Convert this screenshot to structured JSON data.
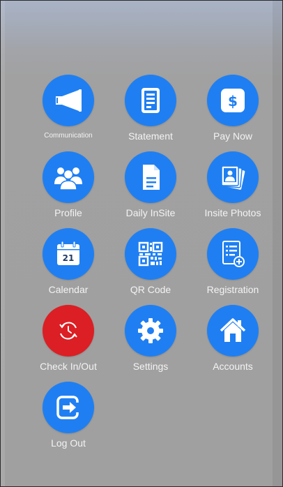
{
  "menu": {
    "communication": "Communication",
    "statement": "Statement",
    "pay_now": "Pay Now",
    "profile": "Profile",
    "daily_insite": "Daily InSite",
    "insite_photos": "Insite Photos",
    "calendar": "Calendar",
    "calendar_day": "21",
    "qr_code": "QR Code",
    "registration": "Registration",
    "check_in_out": "Check In/Out",
    "settings": "Settings",
    "accounts": "Accounts",
    "log_out": "Log Out"
  },
  "colors": {
    "accent": "#1f7ff2",
    "alert": "#db1f24",
    "label": "#f3f3f3",
    "background": "#a0a0a0"
  },
  "icons": [
    "megaphone-icon",
    "statement-icon",
    "dollar-icon",
    "people-icon",
    "document-icon",
    "photos-icon",
    "calendar-icon",
    "qr-code-icon",
    "registration-icon",
    "clock-arrows-icon",
    "gear-icon",
    "home-icon",
    "exit-icon"
  ]
}
